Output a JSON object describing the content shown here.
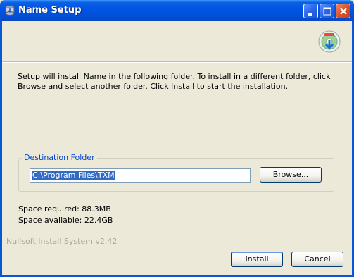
{
  "window": {
    "title": "Name Setup"
  },
  "intro_text": "Setup will install Name in the following folder. To install in a different folder, click Browse and select another folder. Click Install to start the installation.",
  "destination": {
    "group_label": "Destination Folder",
    "path": "C:\\Program Files\\TXM",
    "browse_label": "Browse..."
  },
  "space": {
    "required": "Space required: 88.3MB",
    "available": "Space available: 22.4GB"
  },
  "branding": "Nullsoft Install System v2.42",
  "buttons": {
    "install": "Install",
    "cancel": "Cancel"
  },
  "icons": {
    "app": "installer-app-icon",
    "header": "installer-cd-download-icon",
    "minimize": "minimize-icon",
    "maximize": "maximize-icon",
    "close": "close-icon"
  },
  "colors": {
    "titlebar": "#0054e3",
    "window_bg": "#ece9d8",
    "group_label": "#0046d5",
    "selection": "#316ac5",
    "close_button": "#d9542b"
  }
}
